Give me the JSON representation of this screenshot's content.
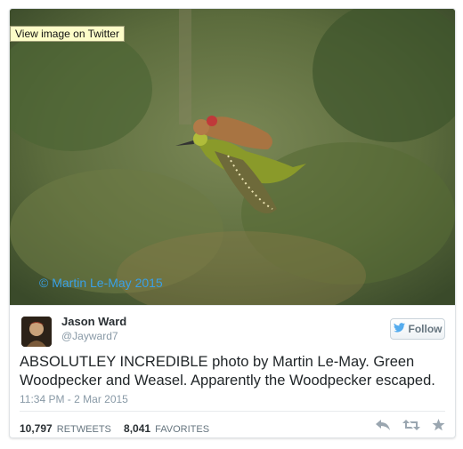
{
  "tooltip": "View image on Twitter",
  "photo_credit": "© Martin Le-May 2015",
  "author": {
    "name": "Jason Ward",
    "handle": "@Jayward7"
  },
  "follow_label": "Follow",
  "tweet_text": "ABSOLUTLEY INCREDIBLE photo by Martin Le-May. Green Woodpecker and Weasel. Apparently the Woodpecker escaped.",
  "timestamp": "11:34 PM - 2 Mar 2015",
  "stats": {
    "retweets_count": "10,797",
    "retweets_label": "RETWEETS",
    "favorites_count": "8,041",
    "favorites_label": "FAVORITES"
  },
  "icons": {
    "reply": "reply-icon",
    "retweet": "retweet-icon",
    "favorite": "favorite-icon",
    "follow_bird": "twitter-bird-icon"
  },
  "colors": {
    "link": "#55acee",
    "credit": "#3aa0e6",
    "text": "#292f33",
    "muted": "#8899a6"
  }
}
